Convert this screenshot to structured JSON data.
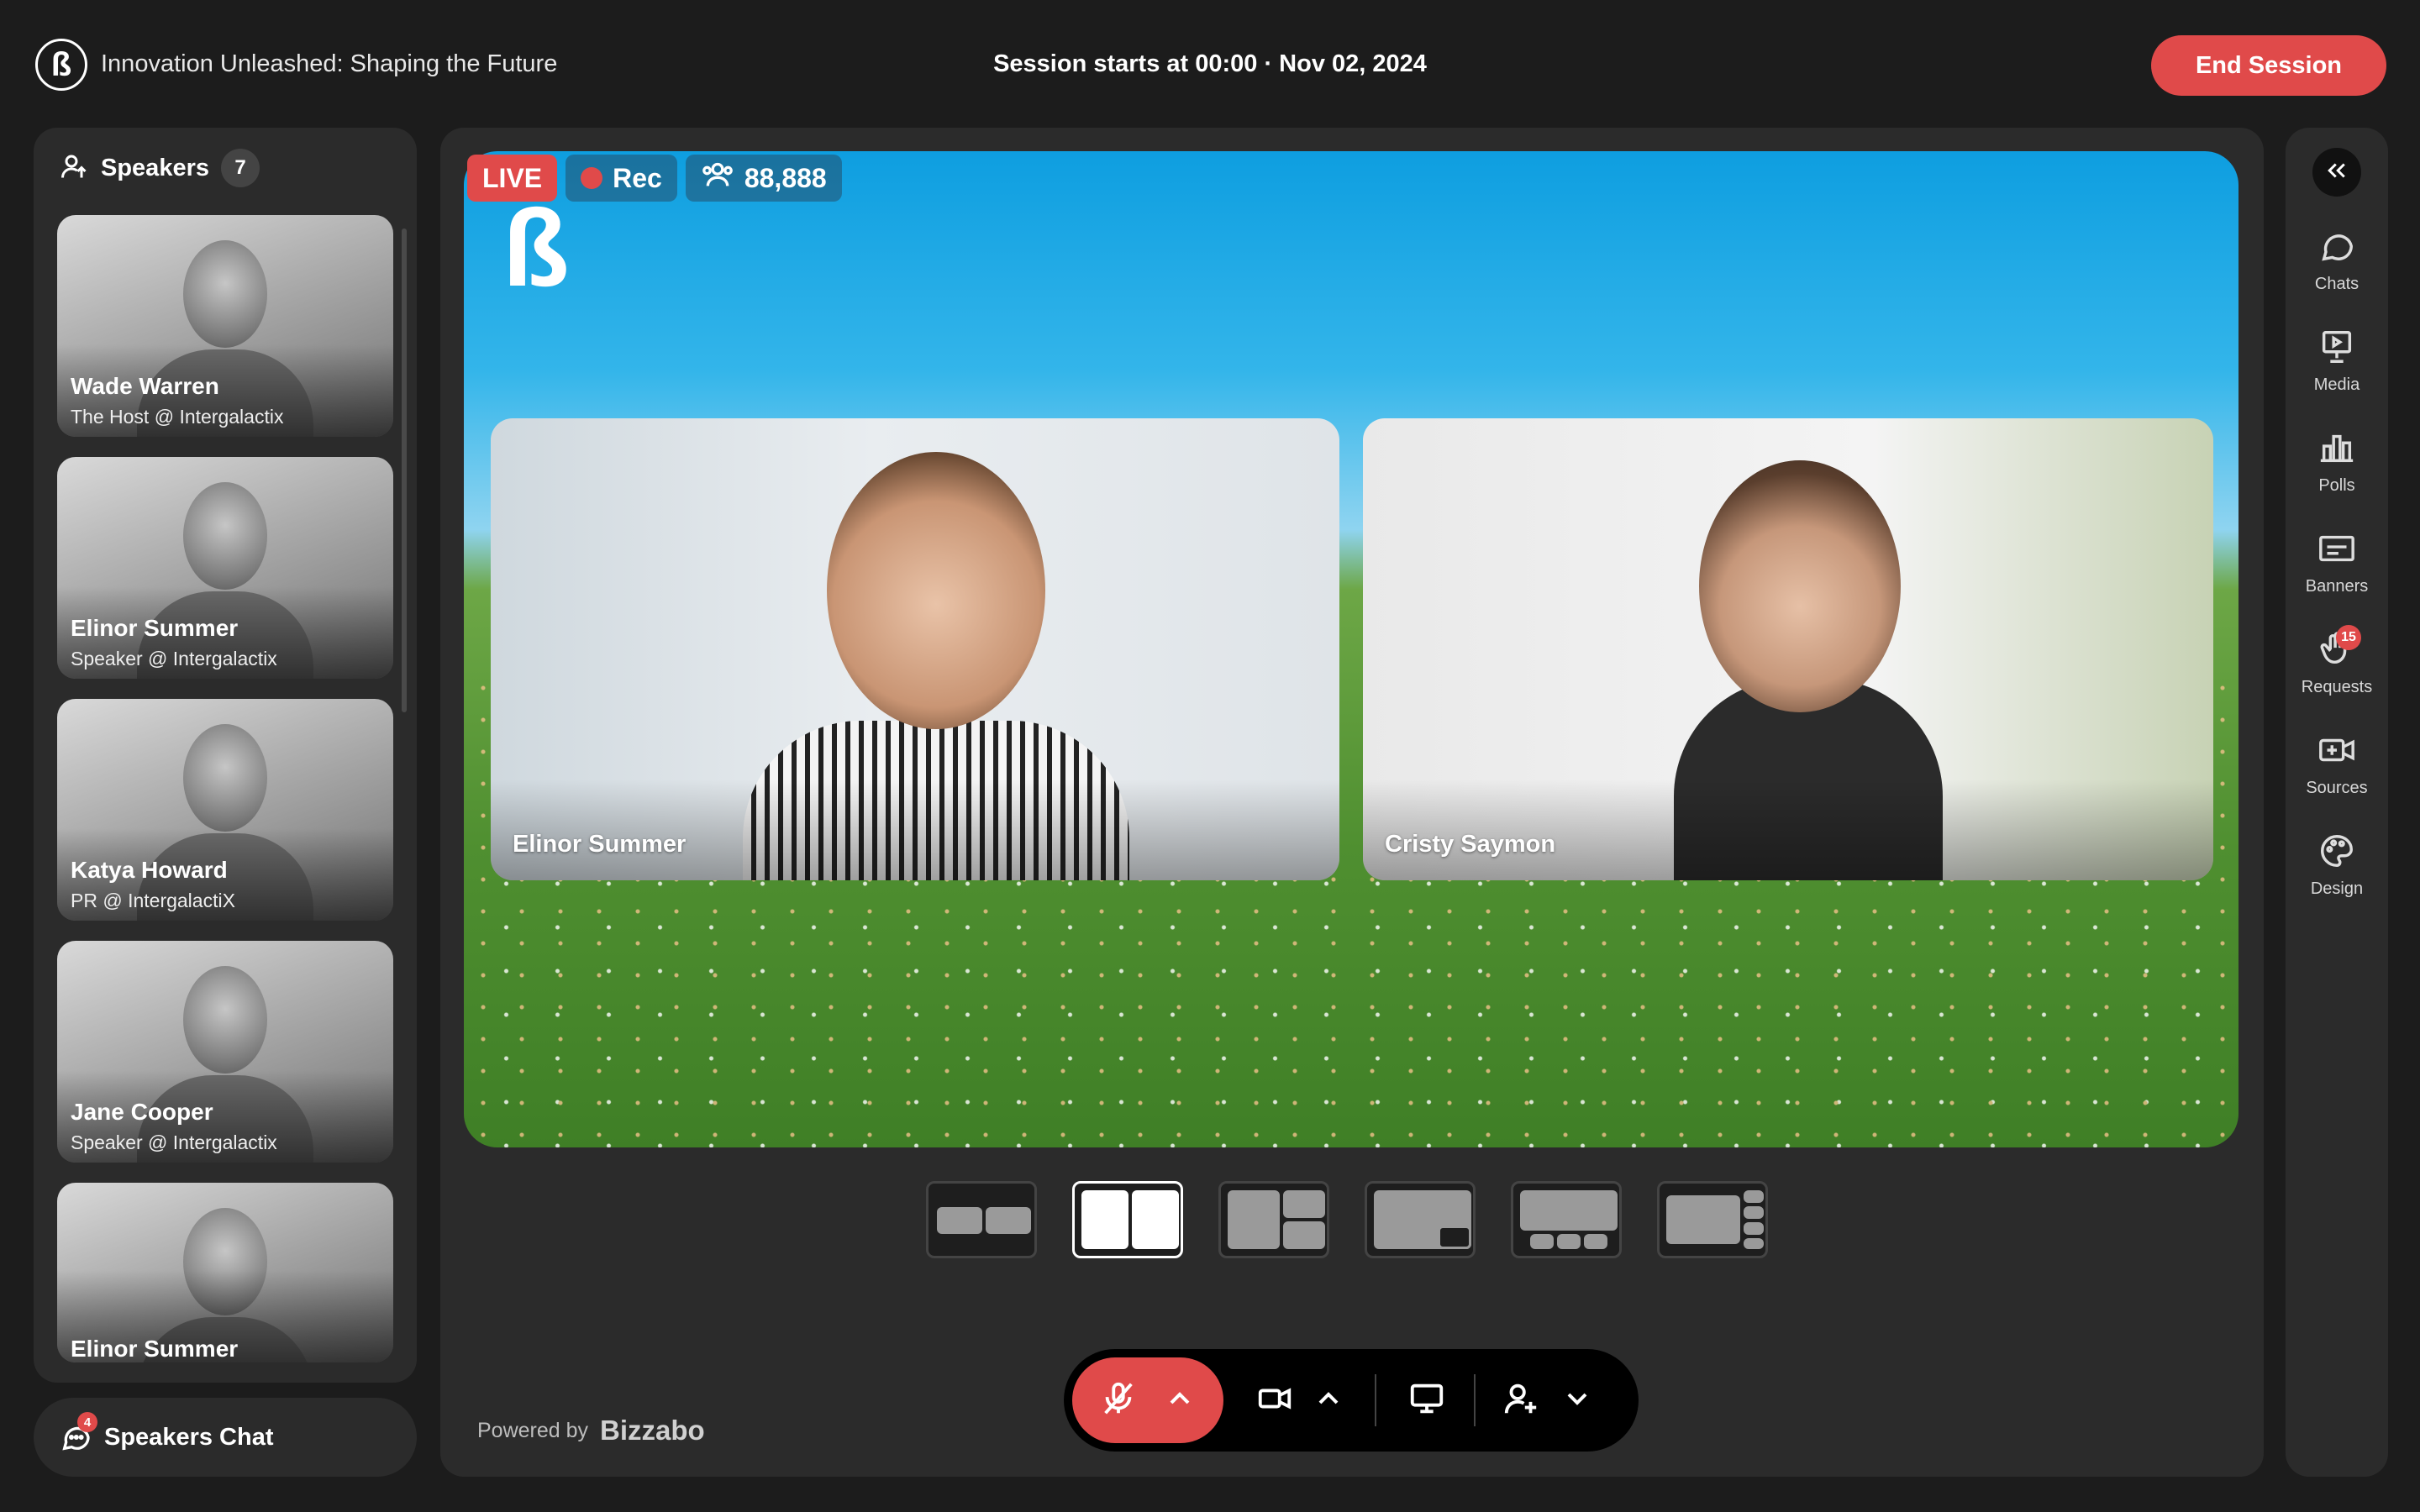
{
  "header": {
    "logo_glyph": "ß",
    "event_title": "Innovation Unleashed: Shaping the Future",
    "session_info": "Session starts at 00:00 · Nov 02, 2024",
    "end_session_label": "End Session"
  },
  "speakers_panel": {
    "title": "Speakers",
    "count": "7",
    "speakers": [
      {
        "name": "Wade Warren",
        "role": "The Host @ Intergalactix"
      },
      {
        "name": "Elinor Summer",
        "role": "Speaker @ Intergalactix"
      },
      {
        "name": "Katya Howard",
        "role": "PR @ IntergalactiX"
      },
      {
        "name": "Jane Cooper",
        "role": "Speaker @ Intergalactix"
      },
      {
        "name": "Elinor Summer",
        "role": ""
      }
    ]
  },
  "speakers_chat": {
    "label": "Speakers Chat",
    "badge": "4"
  },
  "stage": {
    "logo_glyph": "ß",
    "live_label": "LIVE",
    "rec_label": "Rec",
    "viewer_count": "88,888",
    "participants": [
      {
        "name": "Elinor Summer"
      },
      {
        "name": "Cristy Saymon"
      }
    ],
    "selected_layout": 2
  },
  "powered_by": {
    "label": "Powered by",
    "brand": "Bizzabo"
  },
  "right_rail": {
    "items": [
      {
        "label": "Chats",
        "icon": "chat-bubble-icon"
      },
      {
        "label": "Media",
        "icon": "media-presentation-icon"
      },
      {
        "label": "Polls",
        "icon": "bar-chart-icon"
      },
      {
        "label": "Banners",
        "icon": "banner-icon"
      },
      {
        "label": "Requests",
        "icon": "raised-hand-icon",
        "badge": "15"
      },
      {
        "label": "Sources",
        "icon": "video-add-icon"
      },
      {
        "label": "Design",
        "icon": "palette-icon"
      }
    ]
  },
  "colors": {
    "accent": "#e04a4a",
    "panel": "#2b2b2b",
    "background": "#1c1c1c"
  }
}
